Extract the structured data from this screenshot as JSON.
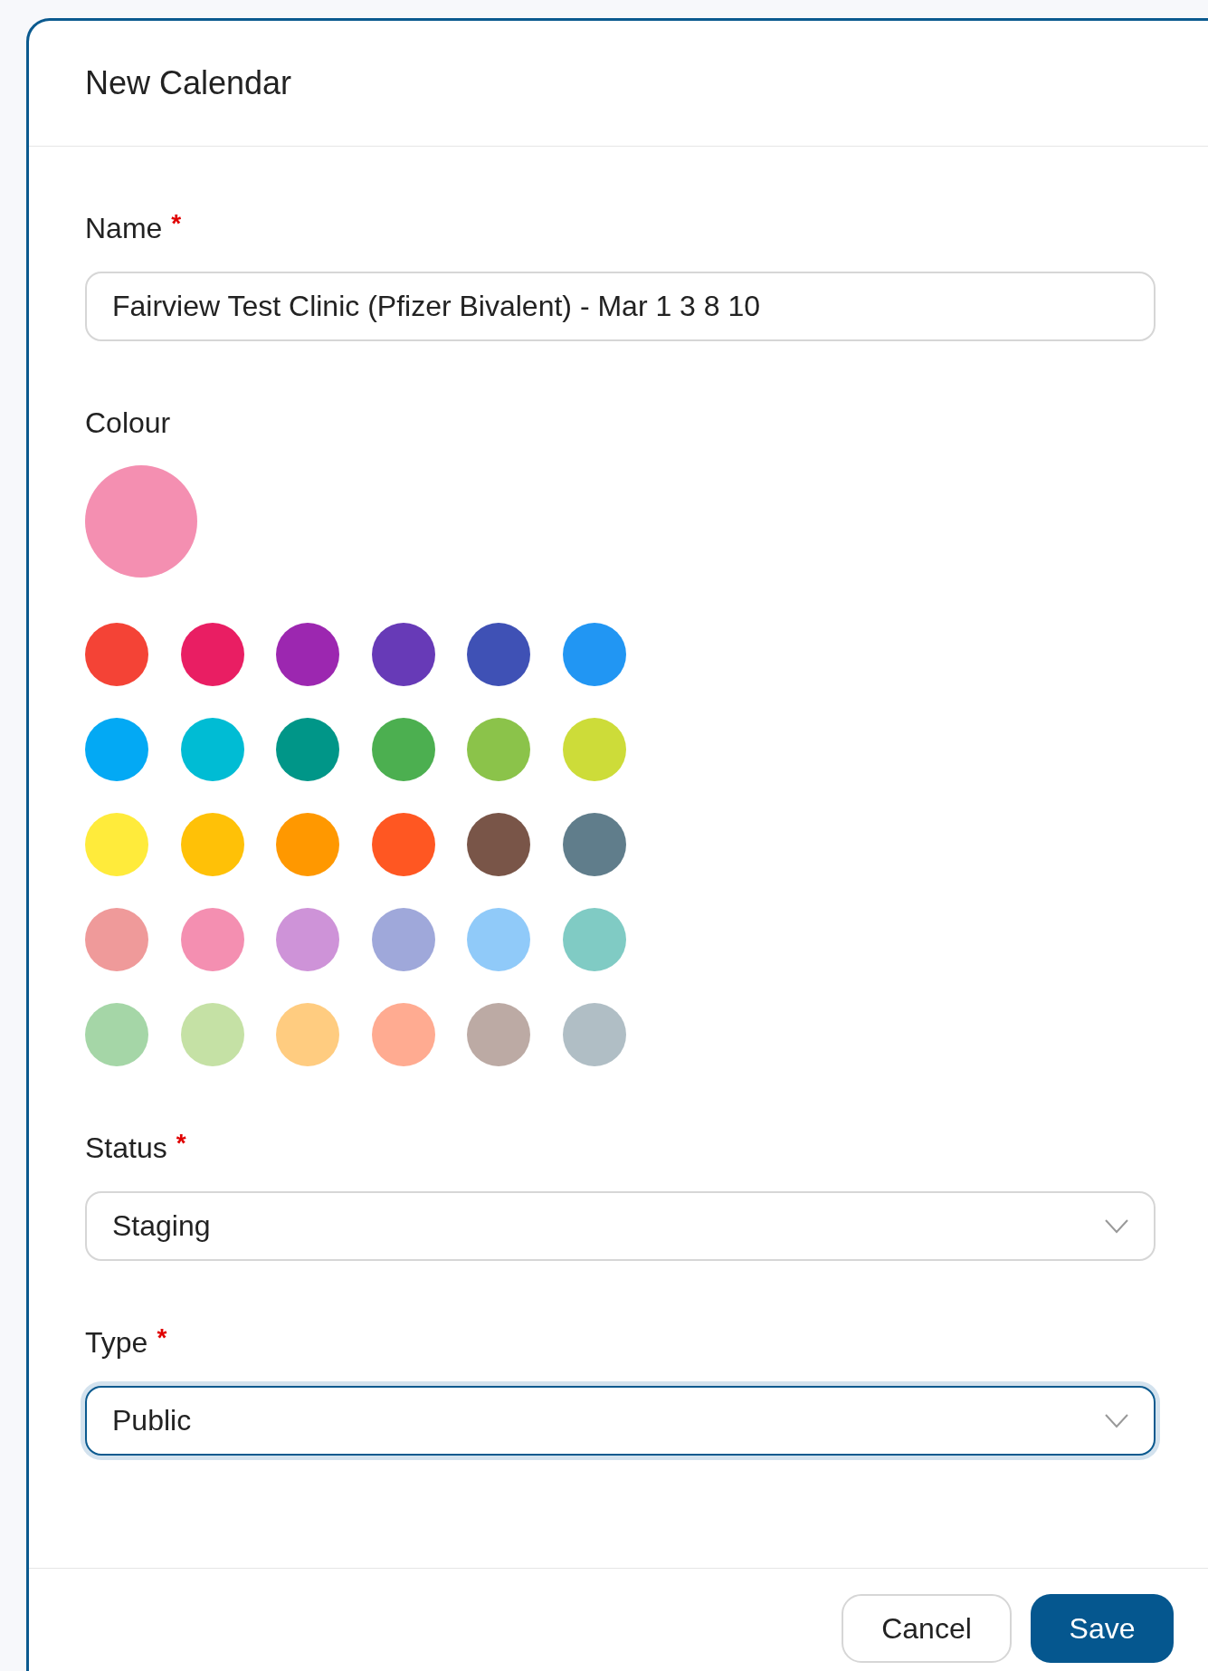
{
  "dialog": {
    "title": "New Calendar"
  },
  "name_field": {
    "label": "Name",
    "required_mark": "*",
    "value": "Fairview Test Clinic (Pfizer Bivalent) - Mar 1 3 8 10"
  },
  "colour": {
    "label": "Colour",
    "swatches": [
      {
        "color": "#f44336",
        "selected": false
      },
      {
        "color": "#e91e63",
        "selected": false
      },
      {
        "color": "#9c27b0",
        "selected": false
      },
      {
        "color": "#673ab7",
        "selected": false
      },
      {
        "color": "#3f51b5",
        "selected": false
      },
      {
        "color": "#2196f3",
        "selected": false
      },
      {
        "color": "#03a9f4",
        "selected": false
      },
      {
        "color": "#00bcd4",
        "selected": false
      },
      {
        "color": "#009688",
        "selected": false
      },
      {
        "color": "#4caf50",
        "selected": false
      },
      {
        "color": "#8bc34a",
        "selected": false
      },
      {
        "color": "#cddc39",
        "selected": false
      },
      {
        "color": "#ffeb3b",
        "selected": false
      },
      {
        "color": "#ffc107",
        "selected": false
      },
      {
        "color": "#ff9800",
        "selected": false
      },
      {
        "color": "#ff5722",
        "selected": false
      },
      {
        "color": "#795548",
        "selected": false
      },
      {
        "color": "#607d8b",
        "selected": false
      },
      {
        "color": "#ef9a9a",
        "selected": false
      },
      {
        "color": "#f48fb1",
        "selected": true
      },
      {
        "color": "#ce93d8",
        "selected": false
      },
      {
        "color": "#9fa8da",
        "selected": false
      },
      {
        "color": "#90caf9",
        "selected": false
      },
      {
        "color": "#80cbc4",
        "selected": false
      },
      {
        "color": "#a5d6a7",
        "selected": false
      },
      {
        "color": "#c5e1a5",
        "selected": false
      },
      {
        "color": "#ffcc80",
        "selected": false
      },
      {
        "color": "#ffab91",
        "selected": false
      },
      {
        "color": "#bcaaa4",
        "selected": false
      },
      {
        "color": "#b0bec5",
        "selected": false
      }
    ]
  },
  "selects": [
    {
      "label": "Status",
      "required_mark": "*",
      "value": "Staging",
      "focused": false
    },
    {
      "label": "Type",
      "required_mark": "*",
      "value": "Public",
      "focused": true
    }
  ],
  "buttons": [
    {
      "label": "Cancel",
      "kind": "secondary"
    },
    {
      "label": "Save",
      "kind": "primary"
    }
  ]
}
